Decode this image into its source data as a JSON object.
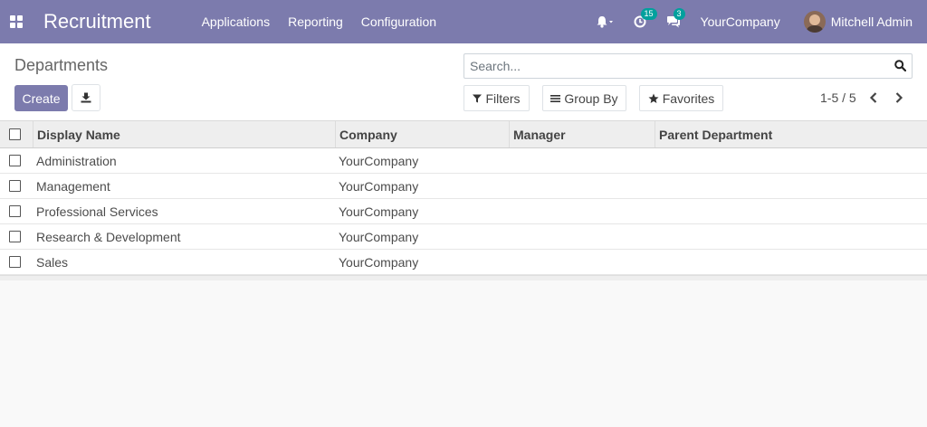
{
  "navbar": {
    "app_title": "Recruitment",
    "menu": [
      "Applications",
      "Reporting",
      "Configuration"
    ],
    "activity_count": "15",
    "message_count": "3",
    "company": "YourCompany",
    "user": "Mitchell Admin",
    "color": "#7c7bad"
  },
  "control_panel": {
    "breadcrumb": "Departments",
    "create_label": "Create",
    "search_placeholder": "Search...",
    "filters_label": "Filters",
    "group_by_label": "Group By",
    "favorites_label": "Favorites",
    "pager": "1-5 / 5"
  },
  "table": {
    "columns": [
      "Display Name",
      "Company",
      "Manager",
      "Parent Department"
    ],
    "rows": [
      {
        "name": "Administration",
        "company": "YourCompany",
        "manager": "",
        "parent": ""
      },
      {
        "name": "Management",
        "company": "YourCompany",
        "manager": "",
        "parent": ""
      },
      {
        "name": "Professional Services",
        "company": "YourCompany",
        "manager": "",
        "parent": ""
      },
      {
        "name": "Research & Development",
        "company": "YourCompany",
        "manager": "",
        "parent": ""
      },
      {
        "name": "Sales",
        "company": "YourCompany",
        "manager": "",
        "parent": ""
      }
    ]
  }
}
